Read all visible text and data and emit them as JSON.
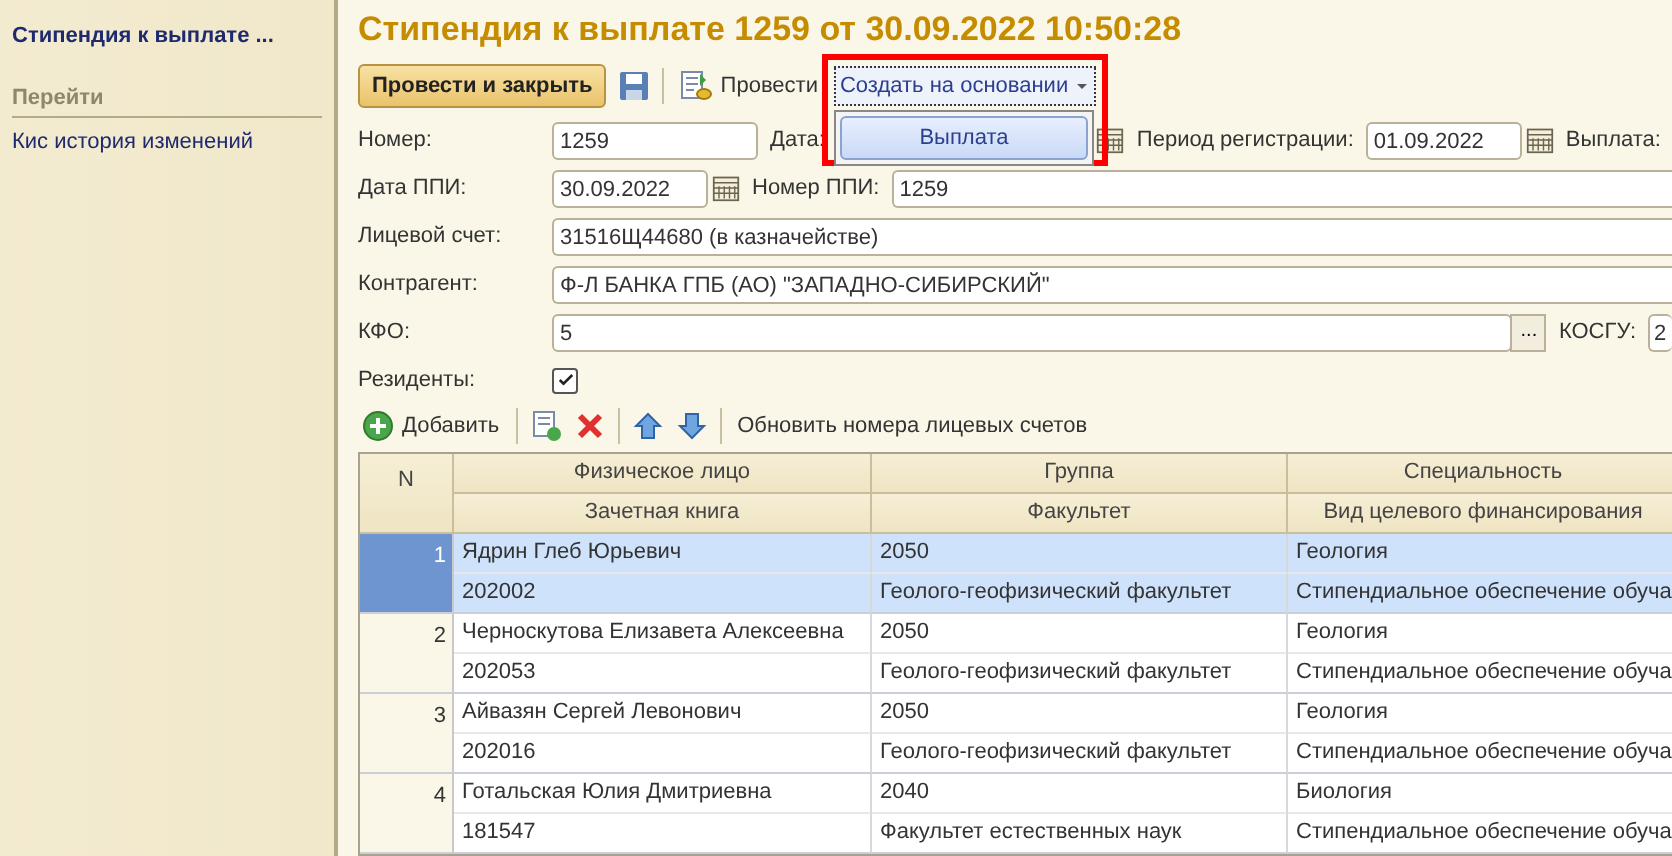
{
  "sidebar": {
    "title": "Стипендия к выплате ...",
    "section_heading": "Перейти",
    "links": [
      "Кис история изменений"
    ]
  },
  "title": "Стипендия к выплате 1259 от 30.09.2022 10:50:28",
  "toolbar": {
    "post_close": "Провести и закрыть",
    "post": "Провести",
    "create_based": {
      "label": "Создать на основании",
      "highlighted": true,
      "expanded": true,
      "menu": [
        {
          "label": "Выплата",
          "selected": true
        }
      ]
    }
  },
  "form_rows": [
    [
      {
        "label": "Номер:",
        "kind": "number",
        "value": "1259"
      },
      {
        "label": "Дата:",
        "kind": "datetime"
      },
      {
        "label": "Период регистрации:",
        "kind": "date",
        "value": "01.09.2022"
      },
      {
        "label": "Выплата:",
        "kind": "none"
      }
    ],
    [
      {
        "label": "Дата ППИ:",
        "kind": "date",
        "value": "30.09.2022"
      },
      {
        "label": "Номер ППИ:",
        "kind": "wide",
        "value": "1259"
      }
    ],
    [
      {
        "label": "Лицевой счет:",
        "kind": "wide",
        "value": "31516Щ44680 (в казначействе)"
      }
    ],
    [
      {
        "label": "Контрагент:",
        "kind": "wide",
        "value": "Ф-Л БАНКА ГПБ (АО) \"ЗАПАДНО-СИБИРСКИЙ\""
      }
    ],
    [
      {
        "label": "КФО:",
        "kind": "select",
        "value": "5",
        "button": "..."
      },
      {
        "label": "КОСГУ:",
        "kind": "stub",
        "value": "2"
      }
    ],
    [
      {
        "label": "Резиденты:",
        "kind": "checkbox",
        "checked": true
      }
    ]
  ],
  "table_toolbar": {
    "add": "Добавить",
    "refresh": "Обновить номера лицевых счетов"
  },
  "table": {
    "columns": [
      {
        "top": "N"
      },
      {
        "top": "Физическое лицо",
        "bottom": "Зачетная книга"
      },
      {
        "top": "Группа",
        "bottom": "Факультет"
      },
      {
        "top": "Специальность",
        "bottom": "Вид целевого финансирования"
      }
    ],
    "rows": [
      {
        "selected": true,
        "cells": [
          [
            "1"
          ],
          [
            "Ядрин Глеб Юрьевич",
            "202002"
          ],
          [
            "2050",
            "Геолого-геофизический факультет"
          ],
          [
            "Геология",
            "Стипендиальное обеспечение обуча"
          ]
        ]
      },
      {
        "selected": false,
        "cells": [
          [
            "2"
          ],
          [
            "Черноскутова Елизавета Алексеевна",
            "202053"
          ],
          [
            "2050",
            "Геолого-геофизический факультет"
          ],
          [
            "Геология",
            "Стипендиальное обеспечение обуча"
          ]
        ]
      },
      {
        "selected": false,
        "cells": [
          [
            "3"
          ],
          [
            "Айвазян Сергей Левонович",
            "202016"
          ],
          [
            "2050",
            "Геолого-геофизический факультет"
          ],
          [
            "Геология",
            "Стипендиальное обеспечение обуча"
          ]
        ]
      },
      {
        "selected": false,
        "cells": [
          [
            "4"
          ],
          [
            "Готальская Юлия Дмитриевна",
            "181547"
          ],
          [
            "2040",
            "Факультет естественных наук"
          ],
          [
            "Биология",
            "Стипендиальное обеспечение обуча"
          ]
        ]
      }
    ]
  }
}
